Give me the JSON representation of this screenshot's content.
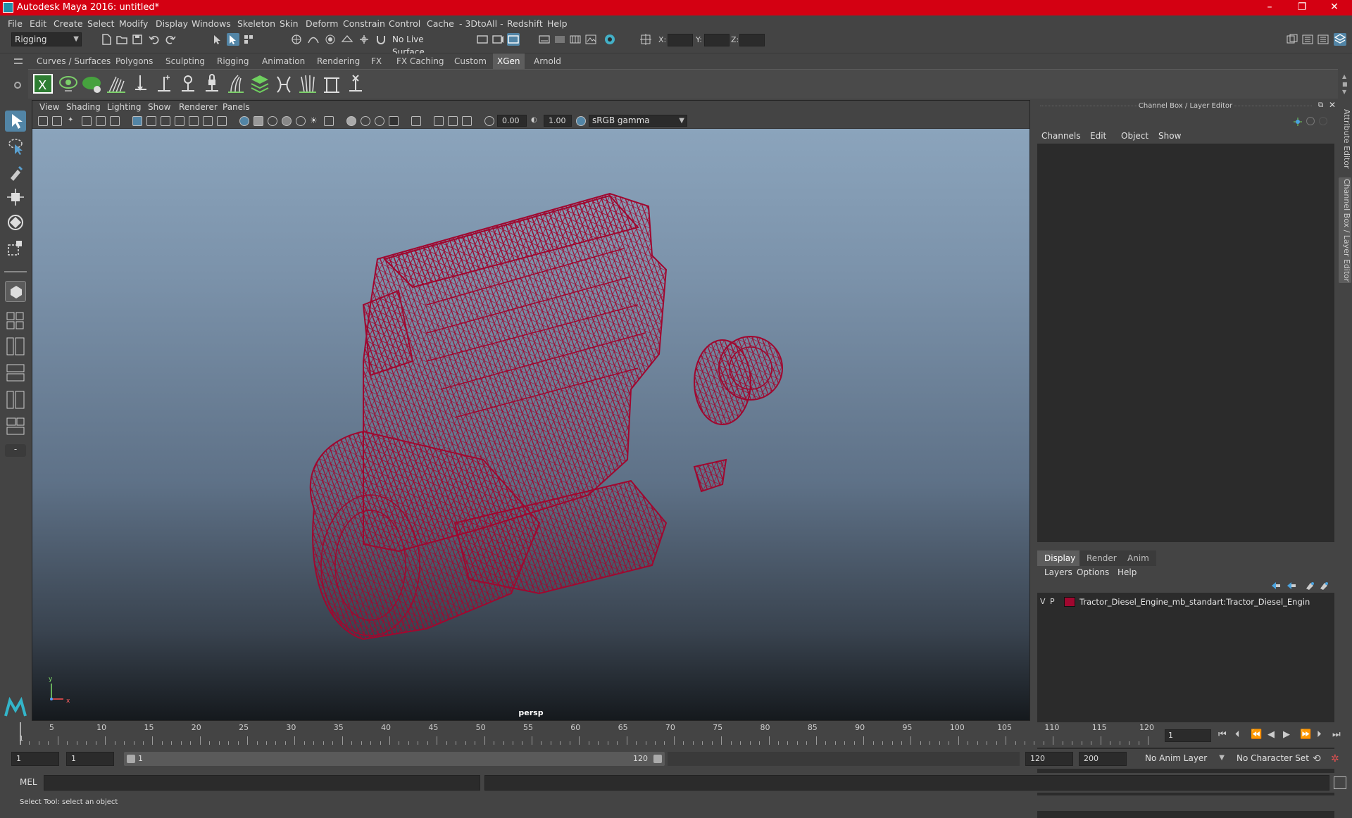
{
  "window": {
    "title": "Autodesk Maya 2016: untitled*",
    "controls": [
      "–",
      "❐",
      "✕"
    ]
  },
  "menubar": {
    "items": [
      "File",
      "Edit",
      "Create",
      "Select",
      "Modify",
      "Display",
      "Windows",
      "Skeleton",
      "Skin",
      "Deform",
      "Constrain",
      "Control",
      "Cache",
      "- 3DtoAll -",
      "Redshift",
      "Help"
    ]
  },
  "statusline": {
    "menuset": "Rigging",
    "live_surface": "No Live Surface",
    "x_label": "X:",
    "y_label": "Y:",
    "z_label": "Z:"
  },
  "shelf": {
    "tabs": [
      "Curves / Surfaces",
      "Polygons",
      "Sculpting",
      "Rigging",
      "Animation",
      "Rendering",
      "FX",
      "FX Caching",
      "Custom",
      "XGen",
      "Arnold"
    ],
    "active_tab": "XGen"
  },
  "viewport": {
    "menus": [
      "View",
      "Shading",
      "Lighting",
      "Show",
      "Renderer",
      "Panels"
    ],
    "exposure": "0.00",
    "gamma": "1.00",
    "color_space": "sRGB gamma",
    "camera": "persp",
    "axis_x": "x",
    "axis_y": "y",
    "wire_color": "#a0072f"
  },
  "rightpanel": {
    "title": "Channel Box / Layer Editor",
    "menus": [
      "Channels",
      "Edit",
      "Object",
      "Show"
    ],
    "tabs": [
      "Display",
      "Render",
      "Anim"
    ],
    "active_tab": "Display",
    "layer_menus": [
      "Layers",
      "Options",
      "Help"
    ],
    "layer": {
      "visible": "V",
      "playback": "P",
      "color": "#a0072f",
      "name": "Tractor_Diesel_Engine_mb_standart:Tractor_Diesel_Engin"
    }
  },
  "sidetabs": [
    "Attribute Editor",
    "Channel Box / Layer Editor"
  ],
  "timeslider": {
    "ticks": [
      "1",
      "5",
      "10",
      "15",
      "20",
      "25",
      "30",
      "35",
      "40",
      "45",
      "50",
      "55",
      "60",
      "65",
      "70",
      "75",
      "80",
      "85",
      "90",
      "95",
      "100",
      "105",
      "110",
      "115",
      "120"
    ],
    "current_frame": "1"
  },
  "rangeslider": {
    "start": "1",
    "inner_start": "1",
    "range_start": "1",
    "range_end": "120",
    "anim_end": "120",
    "max_end": "200",
    "anim_layer": "No Anim Layer",
    "character_set": "No Character Set"
  },
  "cmdline": {
    "lang": "MEL"
  },
  "helpline": {
    "text": "Select Tool: select an object"
  }
}
